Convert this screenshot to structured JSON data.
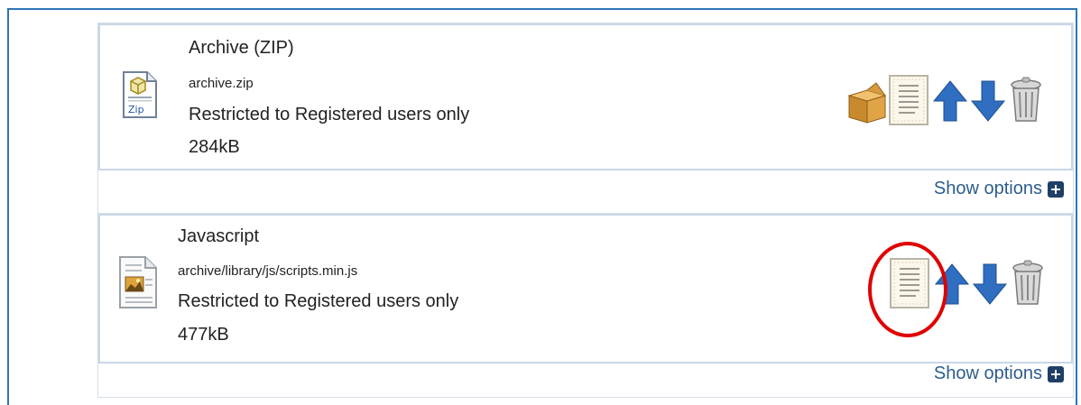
{
  "files": [
    {
      "title": "Archive (ZIP)",
      "filename": "archive.zip",
      "restriction": "Restricted to Registered users only",
      "size": "284kB",
      "file_icon": "zip-file-icon",
      "file_icon_label": "Zip",
      "actions": [
        "open-archive-icon",
        "details-icon",
        "move-up-icon",
        "move-down-icon",
        "delete-icon"
      ],
      "show_options_label": "Show options"
    },
    {
      "title": "Javascript",
      "filename": "archive/library/js/scripts.min.js",
      "restriction": "Restricted to Registered users only",
      "size": "477kB",
      "file_icon": "document-file-icon",
      "actions": [
        "details-icon",
        "move-up-icon",
        "move-down-icon",
        "delete-icon"
      ],
      "show_options_label": "Show options"
    }
  ],
  "colors": {
    "frame_border": "#2e75b6",
    "arrow_blue": "#2f6ec0",
    "highlight_circle": "#e00000",
    "link_text": "#2c5d8f"
  }
}
